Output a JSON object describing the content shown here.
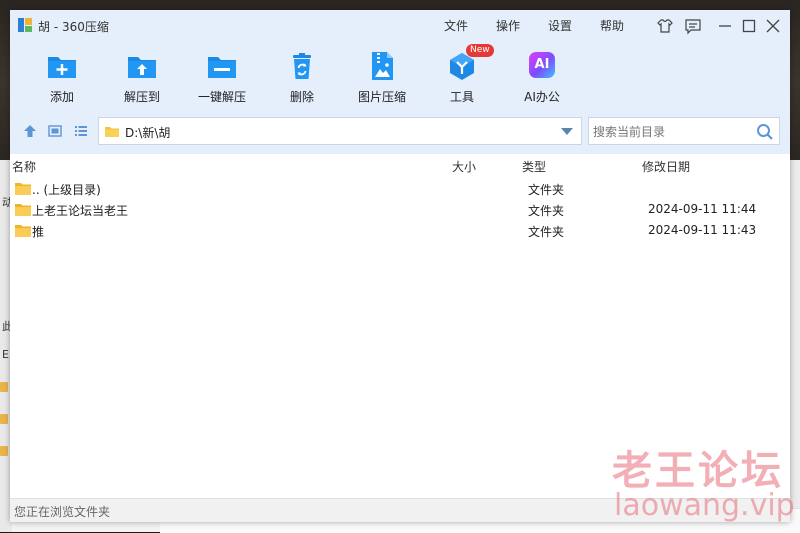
{
  "window": {
    "title": "胡 - 360压缩"
  },
  "menu": [
    "文件",
    "操作",
    "设置",
    "帮助"
  ],
  "toolbar": [
    {
      "label": "添加",
      "icon": "add-folder-icon"
    },
    {
      "label": "解压到",
      "icon": "extract-to-icon"
    },
    {
      "label": "一键解压",
      "icon": "one-click-extract-icon"
    },
    {
      "label": "删除",
      "icon": "recycle-bin-icon"
    },
    {
      "label": "图片压缩",
      "icon": "image-compress-icon"
    },
    {
      "label": "工具",
      "icon": "tools-cube-icon",
      "badge": "New"
    },
    {
      "label": "AI办公",
      "icon": "ai-office-icon",
      "icon_text": "AI"
    }
  ],
  "address": {
    "path": "D:\\新\\胡"
  },
  "search": {
    "placeholder": "搜索当前目录"
  },
  "columns": {
    "name": "名称",
    "size": "大小",
    "type": "类型",
    "modified": "修改日期"
  },
  "files": [
    {
      "name": ".. (上级目录)",
      "type": "文件夹",
      "date": ""
    },
    {
      "name": "上老王论坛当老王",
      "type": "文件夹",
      "date": "2024-09-11 11:44"
    },
    {
      "name": "推",
      "type": "文件夹",
      "date": "2024-09-11 11:43"
    }
  ],
  "status": {
    "text": "您正在浏览文件夹"
  },
  "watermark": {
    "line1": "老王论坛",
    "line2": "laowang.vip"
  },
  "background_fragments": {
    "left_text_1": "动",
    "left_text_2": "此",
    "left_text_3": "E"
  },
  "colors": {
    "accent": "#1e88e5",
    "header_bg": "#e5effb",
    "folder": "#f5c342",
    "badge": "#e53935"
  }
}
